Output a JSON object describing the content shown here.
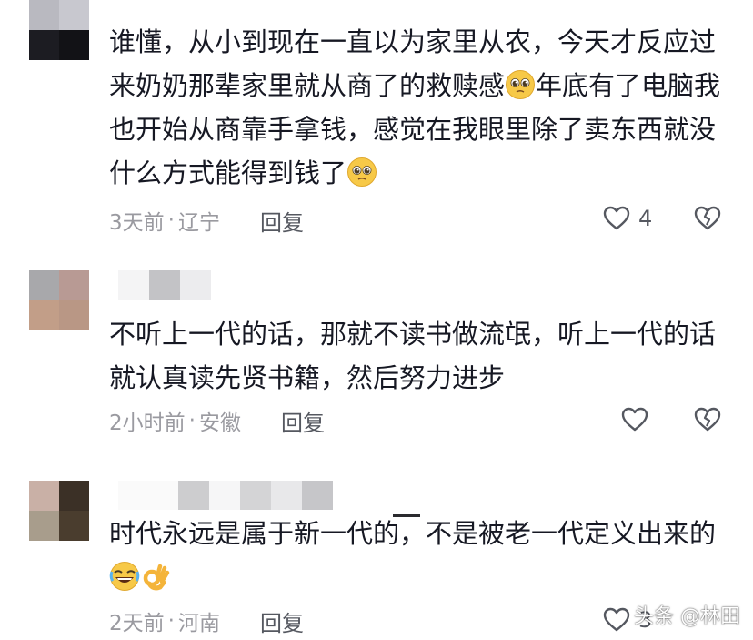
{
  "comments": [
    {
      "text_before": "谁懂，从小到现在一直以为家里从农，今天才反应过来奶奶那辈家里就从商了的救赎感",
      "text_mid": "年底有了电脑我也开始从商靠手拿钱，感觉在我眼里除了卖东西就没什么方式能得到钱了",
      "emoji_1": "pleading-face",
      "emoji_2": "pleading-face",
      "time": "3天前",
      "location": "辽宁",
      "reply_label": "回复",
      "like_count": "4"
    },
    {
      "text": "不听上一代的话，那就不读书做流氓，听上一代的话就认真读先贤书籍，然后努力进步",
      "time": "2小时前",
      "location": "安徽",
      "reply_label": "回复",
      "like_count": ""
    },
    {
      "text": "时代永远是属于新一代的，不是被老一代定义出来的",
      "emoji_1": "rolling-laughing-face",
      "emoji_2": "ok-hand",
      "time": "2天前",
      "location": "河南",
      "reply_label": "回复",
      "like_count": "3"
    }
  ],
  "separator": "·",
  "watermark": "头条 @林田",
  "colors": {
    "text": "#161823",
    "meta": "#9a9aa0",
    "icon": "#555860"
  }
}
